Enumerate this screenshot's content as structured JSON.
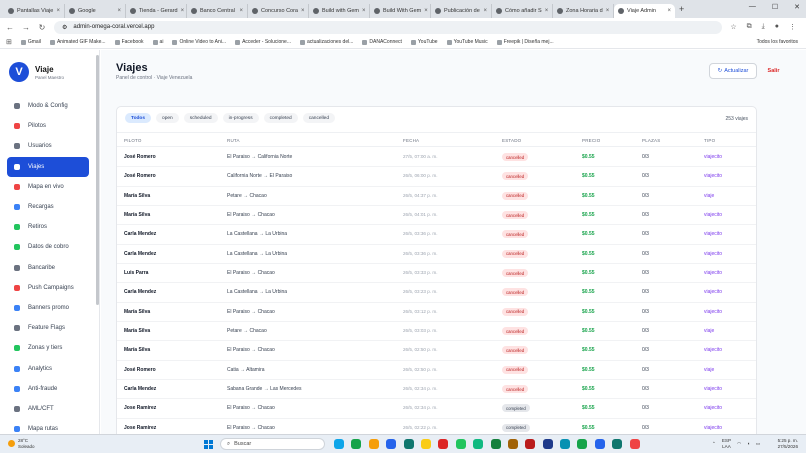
{
  "browser": {
    "tabs": [
      {
        "label": "Pantallas Viaje"
      },
      {
        "label": "Google"
      },
      {
        "label": "Tienda - Gerard"
      },
      {
        "label": "Banco Central"
      },
      {
        "label": "Concurso Cora"
      },
      {
        "label": "Build with Gem"
      },
      {
        "label": "Build With Gem"
      },
      {
        "label": "Publicación de"
      },
      {
        "label": "Cómo añadir S"
      },
      {
        "label": "Zona Horaria d"
      },
      {
        "label": "Viaje Admin"
      }
    ],
    "url": "admin-omega-coral.vercel.app",
    "bookmarks": [
      {
        "label": "Gmail"
      },
      {
        "label": "Animated GIF Make..."
      },
      {
        "label": "Facebook"
      },
      {
        "label": "ai"
      },
      {
        "label": "Online Video to Ani..."
      },
      {
        "label": "Acceder - Solucione..."
      },
      {
        "label": "actualizaciones del..."
      },
      {
        "label": "DANAConnect"
      },
      {
        "label": "YouTube"
      },
      {
        "label": "YouTube Music"
      },
      {
        "label": "Freepik | Diseña mej..."
      }
    ],
    "all_bookmarks": "Todos los favoritos"
  },
  "sidebar": {
    "brand_initial": "V",
    "brand_name": "Viaje",
    "brand_sub": "Panel Maestro",
    "items": [
      {
        "label": "Modo & Config",
        "icon": "sliders-icon",
        "color": "#6b7280"
      },
      {
        "label": "Pilotos",
        "icon": "car-icon",
        "color": "#ef4444"
      },
      {
        "label": "Usuarios",
        "icon": "user-icon",
        "color": "#6b7280"
      },
      {
        "label": "Viajes",
        "icon": "list-icon",
        "color": "#ffffff"
      },
      {
        "label": "Mapa en vivo",
        "icon": "pin-icon",
        "color": "#ef4444"
      },
      {
        "label": "Recargas",
        "icon": "card-icon",
        "color": "#3b82f6"
      },
      {
        "label": "Retiros",
        "icon": "coin-icon",
        "color": "#22c55e"
      },
      {
        "label": "Datos de cobro",
        "icon": "bank-icon",
        "color": "#22c55e"
      },
      {
        "label": "Bancaribe",
        "icon": "building-icon",
        "color": "#6b7280"
      },
      {
        "label": "Push Campaigns",
        "icon": "megaphone-icon",
        "color": "#ef4444"
      },
      {
        "label": "Banners promo",
        "icon": "image-icon",
        "color": "#3b82f6"
      },
      {
        "label": "Feature Flags",
        "icon": "flag-icon",
        "color": "#6b7280"
      },
      {
        "label": "Zonas y tiers",
        "icon": "globe-icon",
        "color": "#22c55e"
      },
      {
        "label": "Analytics",
        "icon": "chart-icon",
        "color": "#3b82f6"
      },
      {
        "label": "Anti-fraude",
        "icon": "shield-icon",
        "color": "#3b82f6"
      },
      {
        "label": "AML/CFT",
        "icon": "bank-icon",
        "color": "#6b7280"
      },
      {
        "label": "Mapa rutas",
        "icon": "map-icon",
        "color": "#3b82f6"
      }
    ]
  },
  "header": {
    "title": "Viajes",
    "subtitle": "Panel de control · Viaje Venezuela",
    "refresh_label": "Actualizar",
    "exit_label": "Salir"
  },
  "filters": [
    "Todos",
    "open",
    "scheduled",
    "in-progress",
    "completed",
    "cancelled"
  ],
  "count_label": "253 viajes",
  "columns": [
    "PILOTO",
    "RUTA",
    "FECHA",
    "ESTADO",
    "PRECIO",
    "PLAZAS",
    "TIPO"
  ],
  "rows": [
    {
      "pilot": "José Romero",
      "route": "El Paraiso → California Norte",
      "date": "27/5, 07:00 a. m.",
      "status": "cancelled",
      "price": "$0.55",
      "seats": "0/3",
      "type": "viajecito"
    },
    {
      "pilot": "José Romero",
      "route": "California Norte → El Paraiso",
      "date": "26/5, 06:00 p. m.",
      "status": "cancelled",
      "price": "$0.55",
      "seats": "0/3",
      "type": "viajecito"
    },
    {
      "pilot": "María Silva",
      "route": "Petare → Chacao",
      "date": "26/5, 04:37 p. m.",
      "status": "cancelled",
      "price": "$0.55",
      "seats": "0/3",
      "type": "viaje"
    },
    {
      "pilot": "María Silva",
      "route": "El Paraiso → Chacao",
      "date": "26/5, 04:01 p. m.",
      "status": "cancelled",
      "price": "$0.55",
      "seats": "0/3",
      "type": "viajecito"
    },
    {
      "pilot": "Carla Mendez",
      "route": "La Castellana → La Urbina",
      "date": "26/5, 03:36 p. m.",
      "status": "cancelled",
      "price": "$0.55",
      "seats": "0/3",
      "type": "viajecito"
    },
    {
      "pilot": "Carla Mendez",
      "route": "La Castellana → La Urbina",
      "date": "26/5, 03:36 p. m.",
      "status": "cancelled",
      "price": "$0.55",
      "seats": "0/3",
      "type": "viajecito"
    },
    {
      "pilot": "Luis Parra",
      "route": "El Paraiso → Chacao",
      "date": "26/5, 03:33 p. m.",
      "status": "cancelled",
      "price": "$0.55",
      "seats": "0/3",
      "type": "viajecito"
    },
    {
      "pilot": "Carla Mendez",
      "route": "La Castellana → La Urbina",
      "date": "26/5, 03:23 p. m.",
      "status": "cancelled",
      "price": "$0.55",
      "seats": "0/3",
      "type": "viajecito"
    },
    {
      "pilot": "María Silva",
      "route": "El Paraiso → Chacao",
      "date": "26/5, 03:12 p. m.",
      "status": "cancelled",
      "price": "$0.55",
      "seats": "0/3",
      "type": "viajecito"
    },
    {
      "pilot": "María Silva",
      "route": "Petare → Chacao",
      "date": "26/5, 03:03 p. m.",
      "status": "cancelled",
      "price": "$0.55",
      "seats": "0/3",
      "type": "viaje"
    },
    {
      "pilot": "María Silva",
      "route": "El Paraiso → Chacao",
      "date": "26/5, 02:50 p. m.",
      "status": "cancelled",
      "price": "$0.55",
      "seats": "0/3",
      "type": "viajecito"
    },
    {
      "pilot": "José Romero",
      "route": "Catia → Altamira",
      "date": "26/5, 02:50 p. m.",
      "status": "cancelled",
      "price": "$0.55",
      "seats": "0/3",
      "type": "viaje"
    },
    {
      "pilot": "Carla Mendez",
      "route": "Sabana Grande → Las Mercedes",
      "date": "26/5, 02:34 p. m.",
      "status": "cancelled",
      "price": "$0.55",
      "seats": "0/3",
      "type": "viajecito"
    },
    {
      "pilot": "Jose Ramirez",
      "route": "El Paraiso → Chacao",
      "date": "26/5, 02:34 p. m.",
      "status": "completed",
      "price": "$0.55",
      "seats": "0/3",
      "type": "viajecito"
    },
    {
      "pilot": "Jose Ramirez",
      "route": "El Paraiso → Chacao",
      "date": "26/5, 02:22 p. m.",
      "status": "completed",
      "price": "$0.55",
      "seats": "0/3",
      "type": "viajecito"
    }
  ],
  "taskbar": {
    "temp": "28°C",
    "weather": "Soleado",
    "search_placeholder": "Buscar",
    "lang_top": "ESP",
    "lang_bottom": "LAA",
    "time": "5:25 p. m.",
    "date": "27/5/2026",
    "app_colors": [
      "#0ea5e9",
      "#16a34a",
      "#f59e0b",
      "#2563eb",
      "#0f766e",
      "#facc15",
      "#dc2626",
      "#22c55e",
      "#10b981",
      "#15803d",
      "#a16207",
      "#b91c1c",
      "#1e3a8a",
      "#0891b2",
      "#16a34a",
      "#2563eb",
      "#0f766e",
      "#ef4444"
    ]
  }
}
